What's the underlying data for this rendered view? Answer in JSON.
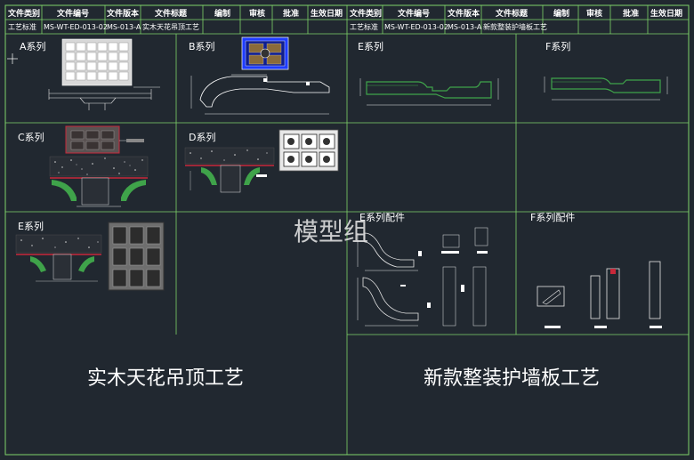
{
  "header_left": {
    "columns": [
      "文件类别",
      "文件编号",
      "文件版本",
      "文件标题",
      "编制",
      "审核",
      "批准",
      "生效日期"
    ],
    "values": [
      "工艺标准",
      "MS-WT-ED-013-02",
      "MS-013-A",
      "实木天花吊顶工艺"
    ]
  },
  "header_right": {
    "columns": [
      "文件类别",
      "文件编号",
      "文件版本",
      "文件标题",
      "编制",
      "审核",
      "批准",
      "生效日期"
    ],
    "values": [
      "工艺标准",
      "MS-WT-ED-013-02",
      "MS-013-A",
      "新款整装护墙板工艺"
    ]
  },
  "panels": {
    "a": "A系列",
    "b": "B系列",
    "c": "C系列",
    "d": "D系列",
    "e": "E系列",
    "e2": "E系列",
    "f": "F系列",
    "e_parts": "E系列配件",
    "f_parts": "F系列配件"
  },
  "captions": {
    "left": "实木天花吊顶工艺",
    "right": "新款整装护墙板工艺"
  },
  "watermark": "模型组",
  "colors": {
    "background": "#212830",
    "grid": "#7fd36a",
    "profile": "#3fa34a",
    "accent": "#c8283a",
    "panel_blue": "#1e3cff"
  }
}
